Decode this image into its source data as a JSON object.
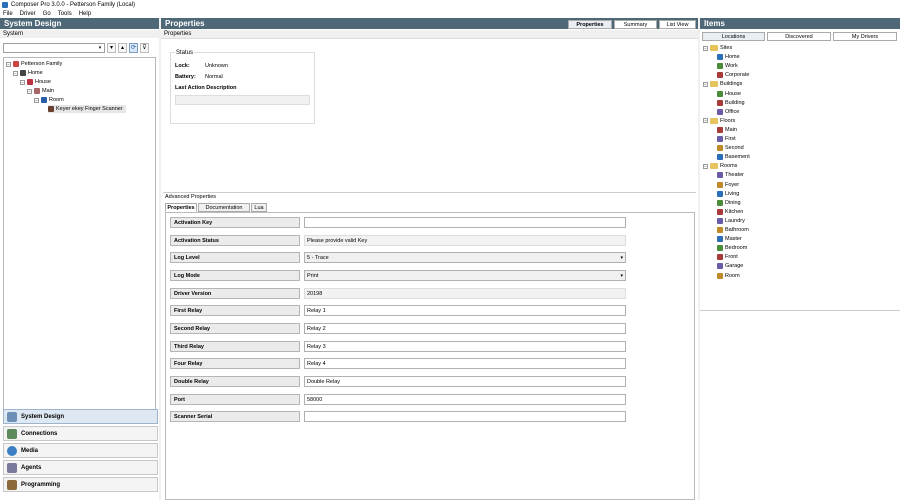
{
  "window": {
    "title": "Composer Pro 3.0.0 - Petterson Family (Local)"
  },
  "menu": [
    "File",
    "Driver",
    "Go",
    "Tools",
    "Help"
  ],
  "left": {
    "header": "System Design",
    "system_label": "System",
    "tree": [
      {
        "label": "Petterson Family"
      },
      {
        "label": "Home"
      },
      {
        "label": "House"
      },
      {
        "label": "Main"
      },
      {
        "label": "Room"
      },
      {
        "label": "Keyer ekey Finger Scanner"
      }
    ],
    "nav": [
      "System Design",
      "Connections",
      "Media",
      "Agents",
      "Programming"
    ]
  },
  "center": {
    "header": "Properties",
    "tabs": [
      "Properties",
      "Summary",
      "List View"
    ],
    "props_label": "Properties",
    "status": {
      "legend": "Status",
      "lock_label": "Lock:",
      "lock_value": "Unknown",
      "battery_label": "Battery:",
      "battery_value": "Normal",
      "last_action_label": "Last Action Description"
    },
    "advanced_label": "Advanced Properties",
    "sub_tabs": [
      "Properties",
      "Documentation",
      "Lua"
    ],
    "props": [
      {
        "label": "Activation Key",
        "value": ""
      },
      {
        "label": "Activation Status",
        "value": "Please provide valid Key"
      },
      {
        "label": "Log Level",
        "value": "5 - Trace"
      },
      {
        "label": "Log Mode",
        "value": "Print"
      },
      {
        "label": "Driver Version",
        "value": "20198"
      },
      {
        "label": "First Relay",
        "value": "Relay 1"
      },
      {
        "label": "Second Relay",
        "value": "Relay 2"
      },
      {
        "label": "Third Relay",
        "value": "Relay 3"
      },
      {
        "label": "Four Relay",
        "value": "Relay 4"
      },
      {
        "label": "Double Relay",
        "value": "Double Relay"
      },
      {
        "label": "Port",
        "value": "58000"
      },
      {
        "label": "Scanner Serial",
        "value": ""
      }
    ]
  },
  "right": {
    "header": "Items",
    "tabs": [
      "Locations",
      "Discovered",
      "My Drivers"
    ],
    "groups": [
      {
        "label": "Sites",
        "items": [
          "Home",
          "Work",
          "Corporate"
        ]
      },
      {
        "label": "Buildings",
        "items": [
          "House",
          "Building",
          "Office"
        ]
      },
      {
        "label": "Floors",
        "items": [
          "Main",
          "First",
          "Second",
          "Basement"
        ]
      },
      {
        "label": "Rooms",
        "items": [
          "Theater",
          "Foyer",
          "Living",
          "Dining",
          "Kitchen",
          "Laundry",
          "Bathroom",
          "Master",
          "Bedroom",
          "Front",
          "Garage",
          "Room"
        ]
      }
    ]
  },
  "colors": {
    "header_bg": "#4f6878",
    "accent": "#1e5aa0"
  }
}
